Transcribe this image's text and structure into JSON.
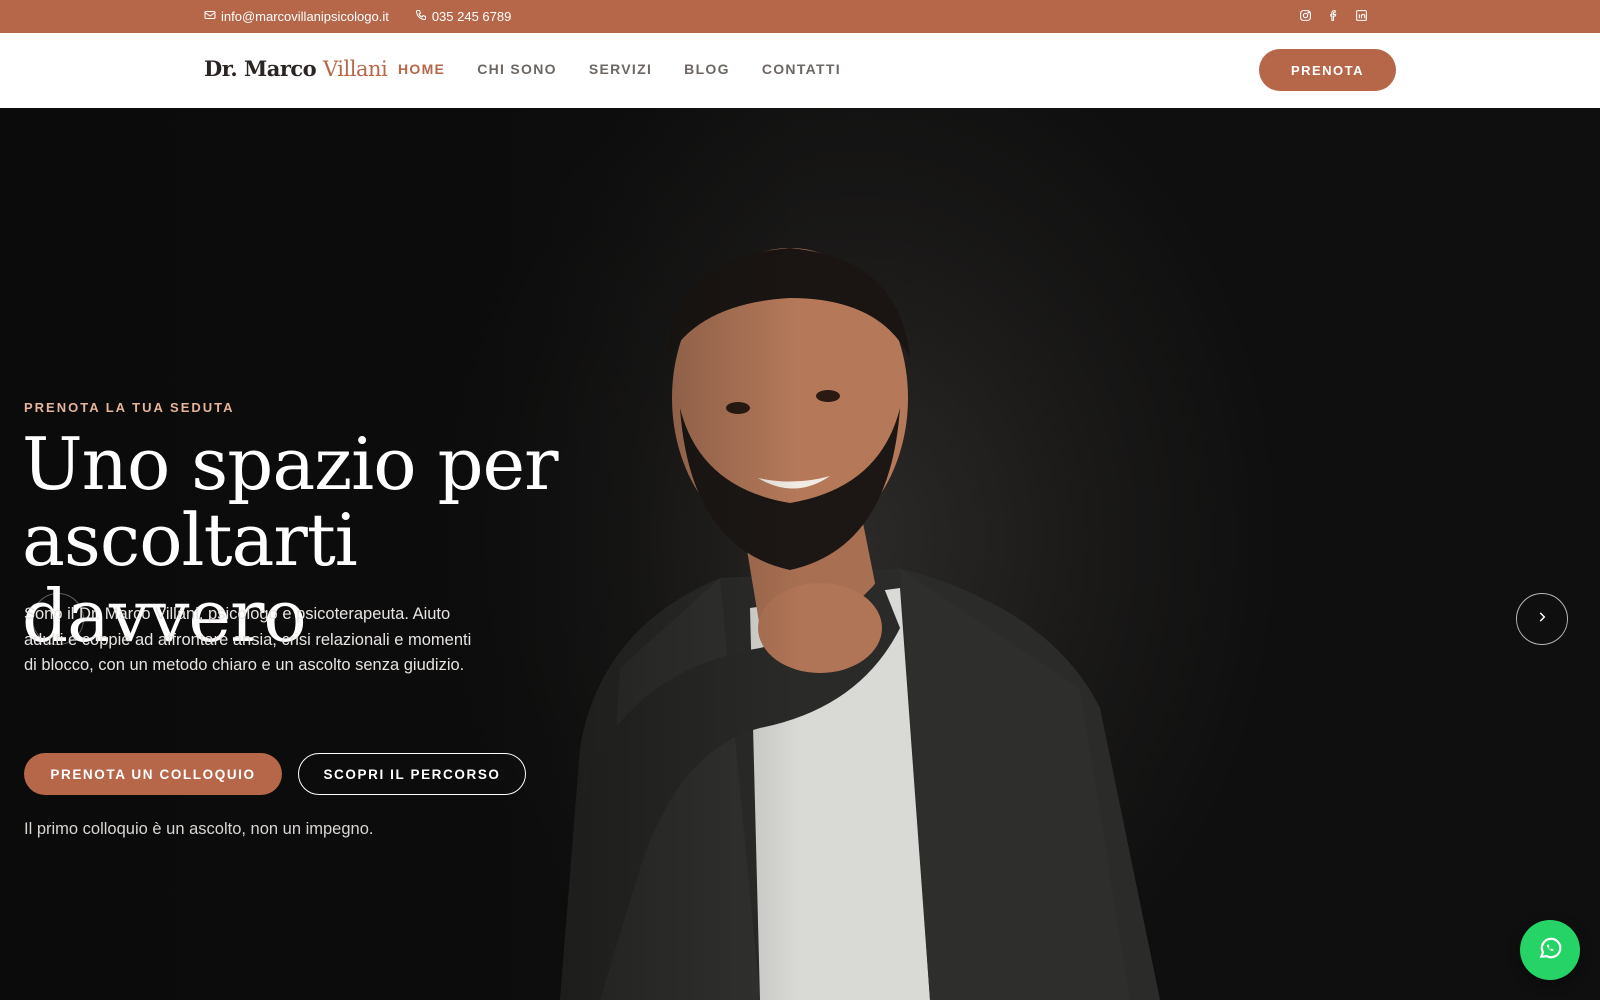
{
  "topbar": {
    "email": "info@marcovillanipsicologo.it",
    "phone": "035 245 6789",
    "social_icons": [
      "instagram-icon",
      "facebook-icon",
      "linkedin-icon"
    ]
  },
  "header": {
    "logo_name": "Dr. Marco",
    "logo_accent": "Villani",
    "nav": [
      {
        "label": "HOME",
        "active": true
      },
      {
        "label": "CHI SONO",
        "active": false
      },
      {
        "label": "SERVIZI",
        "active": false
      },
      {
        "label": "BLOG",
        "active": false
      },
      {
        "label": "CONTATTI",
        "active": false
      }
    ],
    "book_label": "PRENOTA"
  },
  "hero": {
    "eyebrow": "PRENOTA LA TUA SEDUTA",
    "title_line1": "Uno spazio per",
    "title_line2": "ascoltarti davvero",
    "description": "Sono il Dr. Marco Villani, psicologo e psicoterapeuta. Aiuto adulti e coppie ad affrontare ansia, crisi relazionali e momenti di blocco, con un metodo chiaro e un ascolto senza giudizio.",
    "primary_cta": "PRENOTA UN COLLOQUIO",
    "secondary_cta": "SCOPRI IL PERCORSO",
    "note": "Il primo colloquio è un ascolto, non un impegno."
  },
  "colors": {
    "accent": "#b6674a",
    "eyebrow": "#e6b49b",
    "whatsapp": "#25d366"
  }
}
